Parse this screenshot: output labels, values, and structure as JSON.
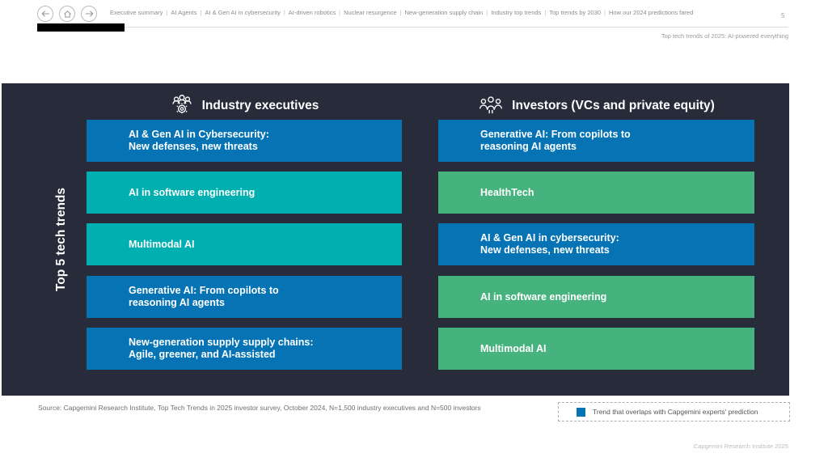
{
  "header": {
    "nav_items": [
      "Executive summary",
      "AI Agents",
      "AI & Gen AI in cybersecurity",
      "AI-driven robotics",
      "Nuclear resurgence",
      "New-generation supply chain",
      "Industry top trends",
      "Top trends by 2030",
      "How our 2024 predictions fared"
    ],
    "page_number": "5",
    "subtitle": "Top tech trends of 2025: AI-powered everything"
  },
  "panel": {
    "side_label": "Top 5 tech trends",
    "columns": [
      {
        "title": "Industry executives",
        "icon": "people-gear-icon",
        "bars": [
          {
            "lines": [
              "AI & Gen AI in Cybersecurity:",
              "New defenses, new threats"
            ],
            "color": "blue"
          },
          {
            "lines": [
              "AI in software engineering"
            ],
            "color": "teal"
          },
          {
            "lines": [
              "Multimodal AI"
            ],
            "color": "teal"
          },
          {
            "lines": [
              "Generative AI: From copilots to",
              "reasoning AI agents"
            ],
            "color": "blue"
          },
          {
            "lines": [
              "New-generation supply supply chains:",
              "Agile, greener, and AI-assisted"
            ],
            "color": "blue"
          }
        ]
      },
      {
        "title": "Investors (VCs and private equity)",
        "icon": "people-group-icon",
        "bars": [
          {
            "lines": [
              "Generative AI: From copilots to",
              "reasoning AI agents"
            ],
            "color": "blue"
          },
          {
            "lines": [
              "HealthTech"
            ],
            "color": "green"
          },
          {
            "lines": [
              "AI & Gen AI in cybersecurity:",
              "New defenses, new threats"
            ],
            "color": "blue"
          },
          {
            "lines": [
              "AI in software engineering"
            ],
            "color": "green"
          },
          {
            "lines": [
              "Multimodal AI"
            ],
            "color": "green"
          }
        ]
      }
    ]
  },
  "colors": {
    "blue": "#0673B4",
    "teal": "#00AFB0",
    "green": "#46B27E",
    "panel": "#272B3A"
  },
  "footer": {
    "source": "Source: Capgemini Research Institute, Top Tech Trends in 2025 investor survey, October 2024, N=1,500 industry executives and N=500 investors",
    "legend_label": "Trend that overlaps with Capgemini experts' prediction",
    "copyright": "Capgemini Research Institute 2025"
  }
}
